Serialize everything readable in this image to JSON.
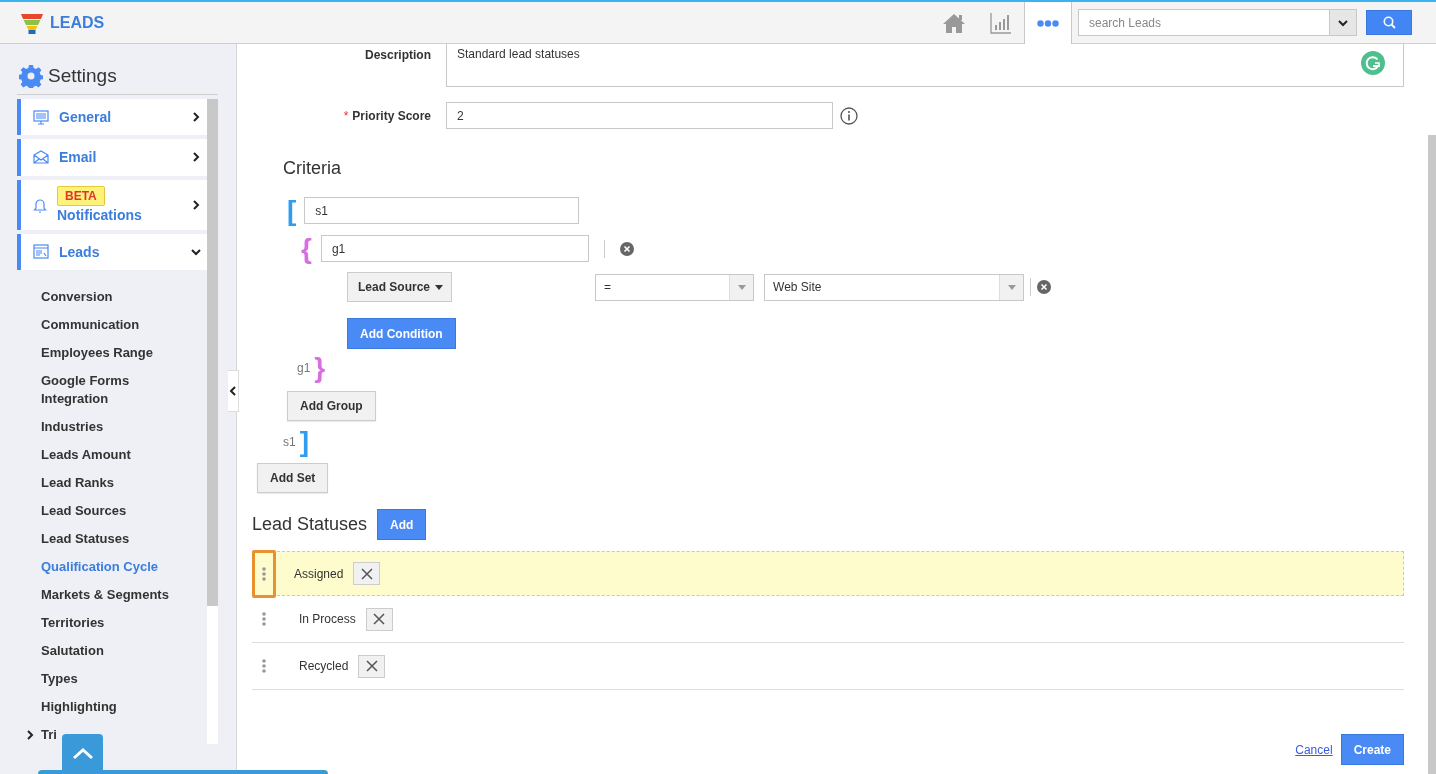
{
  "app": {
    "title": "LEADS"
  },
  "search": {
    "placeholder": "search Leads"
  },
  "sidebar": {
    "title": "Settings",
    "sections": [
      {
        "label": "General",
        "kind": "monitor",
        "expanded": false
      },
      {
        "label": "Email",
        "kind": "mail",
        "expanded": false
      },
      {
        "label": "Notifications",
        "kind": "bell",
        "badge": "BETA",
        "expanded": false
      },
      {
        "label": "Leads",
        "kind": "list",
        "expanded": true
      }
    ],
    "items": [
      {
        "label": "Conversion",
        "selected": false
      },
      {
        "label": "Communication",
        "selected": false
      },
      {
        "label": "Employees Range",
        "selected": false
      },
      {
        "label": "Google Forms Integration",
        "selected": false
      },
      {
        "label": "Industries",
        "selected": false
      },
      {
        "label": "Leads Amount",
        "selected": false
      },
      {
        "label": "Lead Ranks",
        "selected": false
      },
      {
        "label": "Lead Sources",
        "selected": false
      },
      {
        "label": "Lead Statuses",
        "selected": false
      },
      {
        "label": "Qualification Cycle",
        "selected": true
      },
      {
        "label": "Markets & Segments",
        "selected": false
      },
      {
        "label": "Territories",
        "selected": false
      },
      {
        "label": "Salutation",
        "selected": false
      },
      {
        "label": "Types",
        "selected": false
      },
      {
        "label": "Highlighting",
        "selected": false
      },
      {
        "label": "Tri",
        "selected": false,
        "expandable": true
      }
    ]
  },
  "form": {
    "description_label": "Description",
    "description": "Standard lead statuses",
    "required_mark": "*",
    "priority_label": "Priority Score",
    "priority": "2"
  },
  "criteria": {
    "title": "Criteria",
    "set_open": "[",
    "set": "s1",
    "group_open": "{",
    "group": "g1",
    "condition": {
      "field": "Lead Source",
      "operator": "=",
      "value": "Web Site"
    },
    "add_condition": "Add Condition",
    "group_end": "g1",
    "group_close": "}",
    "add_group": "Add Group",
    "set_end": "s1",
    "set_close": "]",
    "add_set": "Add Set"
  },
  "statuses": {
    "title": "Lead Statuses",
    "add": "Add",
    "rows": [
      {
        "label": "Assigned",
        "selected": true
      },
      {
        "label": "In Process",
        "selected": false
      },
      {
        "label": "Recycled",
        "selected": false
      }
    ]
  },
  "footer": {
    "cancel": "Cancel",
    "create": "Create"
  }
}
